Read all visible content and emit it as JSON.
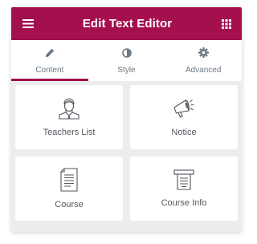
{
  "header": {
    "title": "Edit Text Editor",
    "menu_icon": "hamburger-icon",
    "apps_icon": "grid-icon"
  },
  "tabs": [
    {
      "label": "Content",
      "icon": "pencil-icon",
      "active": true
    },
    {
      "label": "Style",
      "icon": "half-circle-icon",
      "active": false
    },
    {
      "label": "Advanced",
      "icon": "gear-icon",
      "active": false
    }
  ],
  "widgets": [
    {
      "label": "Teachers List",
      "icon": "teacher-icon"
    },
    {
      "label": "Notice",
      "icon": "megaphone-icon"
    },
    {
      "label": "Course",
      "icon": "document-icon"
    },
    {
      "label": "Course Info",
      "icon": "info-board-icon"
    }
  ],
  "colors": {
    "accent": "#a4104e",
    "text": "#51575d",
    "tab_text": "#6d7882",
    "panel_bg": "#ededee"
  }
}
